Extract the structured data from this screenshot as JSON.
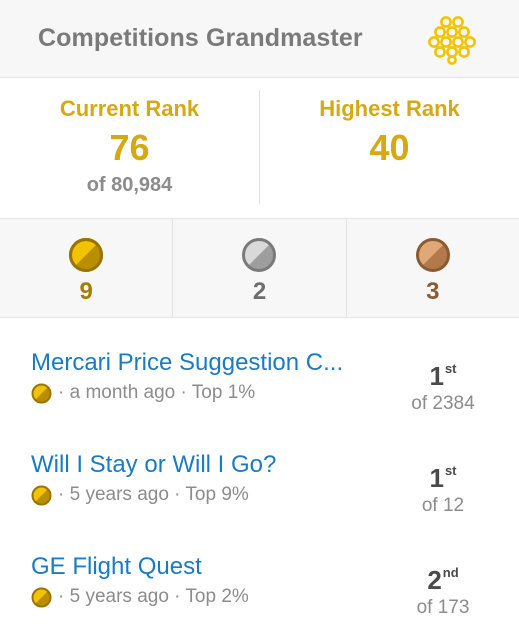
{
  "header": {
    "title": "Competitions Grandmaster",
    "tier_icon": "grandmaster-tier-icon",
    "tier_color": "#f2c300"
  },
  "rank": {
    "current_label": "Current Rank",
    "current_value": "76",
    "current_sub": "of 80,984",
    "highest_label": "Highest Rank",
    "highest_value": "40",
    "accent_color": "#d6a912"
  },
  "medals": {
    "gold": {
      "icon": "gold-medal-icon",
      "count": "9",
      "color": "#c79a00"
    },
    "silver": {
      "icon": "silver-medal-icon",
      "count": "2",
      "color": "#8a8a8a"
    },
    "bronze": {
      "icon": "bronze-medal-icon",
      "count": "3",
      "color": "#a9703f"
    }
  },
  "competitions": [
    {
      "title": "Mercari Price Suggestion C...",
      "medal": "gold-medal-icon",
      "meta": "· a month ago · Top 1%",
      "place": "1",
      "suffix": "st",
      "total": "of 2384"
    },
    {
      "title": "Will I Stay or Will I Go?",
      "medal": "gold-medal-icon",
      "meta": "· 5 years ago · Top 9%",
      "place": "1",
      "suffix": "st",
      "total": "of 12"
    },
    {
      "title": "GE Flight Quest",
      "medal": "gold-medal-icon",
      "meta": "· 5 years ago · Top 2%",
      "place": "2",
      "suffix": "nd",
      "total": "of 173"
    }
  ]
}
